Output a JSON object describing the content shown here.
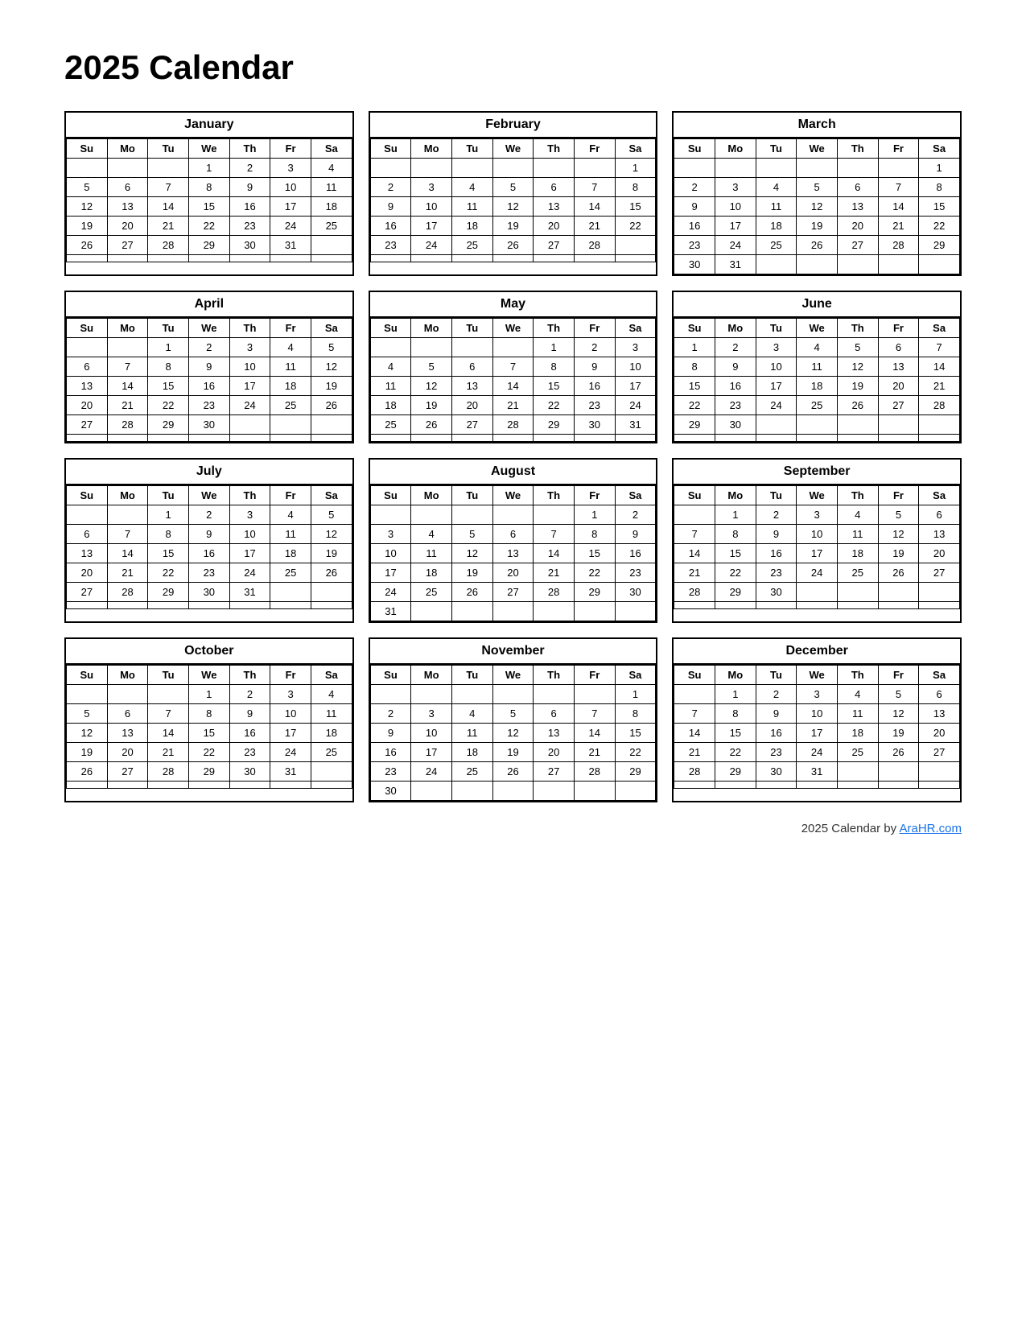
{
  "title": "2025 Calendar",
  "footer": {
    "text": "2025  Calendar by ",
    "link_text": "AraHR.com",
    "link_url": "#"
  },
  "months": [
    {
      "name": "January",
      "days": [
        "Su",
        "Mo",
        "Tu",
        "We",
        "Th",
        "Fr",
        "Sa"
      ],
      "weeks": [
        [
          "",
          "",
          "",
          "1",
          "2",
          "3",
          "4"
        ],
        [
          "5",
          "6",
          "7",
          "8",
          "9",
          "10",
          "11"
        ],
        [
          "12",
          "13",
          "14",
          "15",
          "16",
          "17",
          "18"
        ],
        [
          "19",
          "20",
          "21",
          "22",
          "23",
          "24",
          "25"
        ],
        [
          "26",
          "27",
          "28",
          "29",
          "30",
          "31",
          ""
        ],
        [
          "",
          "",
          "",
          "",
          "",
          "",
          ""
        ]
      ]
    },
    {
      "name": "February",
      "days": [
        "Su",
        "Mo",
        "Tu",
        "We",
        "Th",
        "Fr",
        "Sa"
      ],
      "weeks": [
        [
          "",
          "",
          "",
          "",
          "",
          "",
          "1"
        ],
        [
          "2",
          "3",
          "4",
          "5",
          "6",
          "7",
          "8"
        ],
        [
          "9",
          "10",
          "11",
          "12",
          "13",
          "14",
          "15"
        ],
        [
          "16",
          "17",
          "18",
          "19",
          "20",
          "21",
          "22"
        ],
        [
          "23",
          "24",
          "25",
          "26",
          "27",
          "28",
          ""
        ],
        [
          "",
          "",
          "",
          "",
          "",
          "",
          ""
        ]
      ]
    },
    {
      "name": "March",
      "days": [
        "Su",
        "Mo",
        "Tu",
        "We",
        "Th",
        "Fr",
        "Sa"
      ],
      "weeks": [
        [
          "",
          "",
          "",
          "",
          "",
          "",
          "1"
        ],
        [
          "2",
          "3",
          "4",
          "5",
          "6",
          "7",
          "8"
        ],
        [
          "9",
          "10",
          "11",
          "12",
          "13",
          "14",
          "15"
        ],
        [
          "16",
          "17",
          "18",
          "19",
          "20",
          "21",
          "22"
        ],
        [
          "23",
          "24",
          "25",
          "26",
          "27",
          "28",
          "29"
        ],
        [
          "30",
          "31",
          "",
          "",
          "",
          "",
          ""
        ]
      ]
    },
    {
      "name": "April",
      "days": [
        "Su",
        "Mo",
        "Tu",
        "We",
        "Th",
        "Fr",
        "Sa"
      ],
      "weeks": [
        [
          "",
          "",
          "1",
          "2",
          "3",
          "4",
          "5"
        ],
        [
          "6",
          "7",
          "8",
          "9",
          "10",
          "11",
          "12"
        ],
        [
          "13",
          "14",
          "15",
          "16",
          "17",
          "18",
          "19"
        ],
        [
          "20",
          "21",
          "22",
          "23",
          "24",
          "25",
          "26"
        ],
        [
          "27",
          "28",
          "29",
          "30",
          "",
          "",
          ""
        ],
        [
          "",
          "",
          "",
          "",
          "",
          "",
          ""
        ]
      ]
    },
    {
      "name": "May",
      "days": [
        "Su",
        "Mo",
        "Tu",
        "We",
        "Th",
        "Fr",
        "Sa"
      ],
      "weeks": [
        [
          "",
          "",
          "",
          "",
          "1",
          "2",
          "3"
        ],
        [
          "4",
          "5",
          "6",
          "7",
          "8",
          "9",
          "10"
        ],
        [
          "11",
          "12",
          "13",
          "14",
          "15",
          "16",
          "17"
        ],
        [
          "18",
          "19",
          "20",
          "21",
          "22",
          "23",
          "24"
        ],
        [
          "25",
          "26",
          "27",
          "28",
          "29",
          "30",
          "31"
        ],
        [
          "",
          "",
          "",
          "",
          "",
          "",
          ""
        ]
      ]
    },
    {
      "name": "June",
      "days": [
        "Su",
        "Mo",
        "Tu",
        "We",
        "Th",
        "Fr",
        "Sa"
      ],
      "weeks": [
        [
          "1",
          "2",
          "3",
          "4",
          "5",
          "6",
          "7"
        ],
        [
          "8",
          "9",
          "10",
          "11",
          "12",
          "13",
          "14"
        ],
        [
          "15",
          "16",
          "17",
          "18",
          "19",
          "20",
          "21"
        ],
        [
          "22",
          "23",
          "24",
          "25",
          "26",
          "27",
          "28"
        ],
        [
          "29",
          "30",
          "",
          "",
          "",
          "",
          ""
        ],
        [
          "",
          "",
          "",
          "",
          "",
          "",
          ""
        ]
      ]
    },
    {
      "name": "July",
      "days": [
        "Su",
        "Mo",
        "Tu",
        "We",
        "Th",
        "Fr",
        "Sa"
      ],
      "weeks": [
        [
          "",
          "",
          "1",
          "2",
          "3",
          "4",
          "5"
        ],
        [
          "6",
          "7",
          "8",
          "9",
          "10",
          "11",
          "12"
        ],
        [
          "13",
          "14",
          "15",
          "16",
          "17",
          "18",
          "19"
        ],
        [
          "20",
          "21",
          "22",
          "23",
          "24",
          "25",
          "26"
        ],
        [
          "27",
          "28",
          "29",
          "30",
          "31",
          "",
          ""
        ],
        [
          "",
          "",
          "",
          "",
          "",
          "",
          ""
        ]
      ]
    },
    {
      "name": "August",
      "days": [
        "Su",
        "Mo",
        "Tu",
        "We",
        "Th",
        "Fr",
        "Sa"
      ],
      "weeks": [
        [
          "",
          "",
          "",
          "",
          "",
          "1",
          "2"
        ],
        [
          "3",
          "4",
          "5",
          "6",
          "7",
          "8",
          "9"
        ],
        [
          "10",
          "11",
          "12",
          "13",
          "14",
          "15",
          "16"
        ],
        [
          "17",
          "18",
          "19",
          "20",
          "21",
          "22",
          "23"
        ],
        [
          "24",
          "25",
          "26",
          "27",
          "28",
          "29",
          "30"
        ],
        [
          "31",
          "",
          "",
          "",
          "",
          "",
          ""
        ]
      ]
    },
    {
      "name": "September",
      "days": [
        "Su",
        "Mo",
        "Tu",
        "We",
        "Th",
        "Fr",
        "Sa"
      ],
      "weeks": [
        [
          "",
          "1",
          "2",
          "3",
          "4",
          "5",
          "6"
        ],
        [
          "7",
          "8",
          "9",
          "10",
          "11",
          "12",
          "13"
        ],
        [
          "14",
          "15",
          "16",
          "17",
          "18",
          "19",
          "20"
        ],
        [
          "21",
          "22",
          "23",
          "24",
          "25",
          "26",
          "27"
        ],
        [
          "28",
          "29",
          "30",
          "",
          "",
          "",
          ""
        ],
        [
          "",
          "",
          "",
          "",
          "",
          "",
          ""
        ]
      ]
    },
    {
      "name": "October",
      "days": [
        "Su",
        "Mo",
        "Tu",
        "We",
        "Th",
        "Fr",
        "Sa"
      ],
      "weeks": [
        [
          "",
          "",
          "",
          "1",
          "2",
          "3",
          "4"
        ],
        [
          "5",
          "6",
          "7",
          "8",
          "9",
          "10",
          "11"
        ],
        [
          "12",
          "13",
          "14",
          "15",
          "16",
          "17",
          "18"
        ],
        [
          "19",
          "20",
          "21",
          "22",
          "23",
          "24",
          "25"
        ],
        [
          "26",
          "27",
          "28",
          "29",
          "30",
          "31",
          ""
        ],
        [
          "",
          "",
          "",
          "",
          "",
          "",
          ""
        ]
      ]
    },
    {
      "name": "November",
      "days": [
        "Su",
        "Mo",
        "Tu",
        "We",
        "Th",
        "Fr",
        "Sa"
      ],
      "weeks": [
        [
          "",
          "",
          "",
          "",
          "",
          "",
          "1"
        ],
        [
          "2",
          "3",
          "4",
          "5",
          "6",
          "7",
          "8"
        ],
        [
          "9",
          "10",
          "11",
          "12",
          "13",
          "14",
          "15"
        ],
        [
          "16",
          "17",
          "18",
          "19",
          "20",
          "21",
          "22"
        ],
        [
          "23",
          "24",
          "25",
          "26",
          "27",
          "28",
          "29"
        ],
        [
          "30",
          "",
          "",
          "",
          "",
          "",
          ""
        ]
      ]
    },
    {
      "name": "December",
      "days": [
        "Su",
        "Mo",
        "Tu",
        "We",
        "Th",
        "Fr",
        "Sa"
      ],
      "weeks": [
        [
          "",
          "1",
          "2",
          "3",
          "4",
          "5",
          "6"
        ],
        [
          "7",
          "8",
          "9",
          "10",
          "11",
          "12",
          "13"
        ],
        [
          "14",
          "15",
          "16",
          "17",
          "18",
          "19",
          "20"
        ],
        [
          "21",
          "22",
          "23",
          "24",
          "25",
          "26",
          "27"
        ],
        [
          "28",
          "29",
          "30",
          "31",
          "",
          "",
          ""
        ],
        [
          "",
          "",
          "",
          "",
          "",
          "",
          ""
        ]
      ]
    }
  ]
}
